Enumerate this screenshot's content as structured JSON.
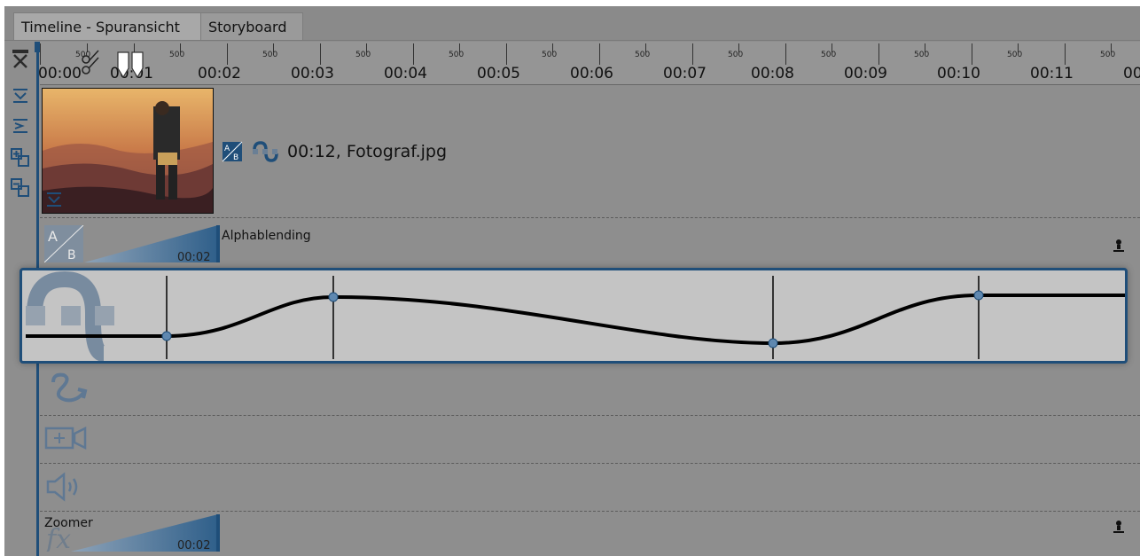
{
  "tabs": [
    {
      "label": "Timeline - Spuransicht",
      "active": true
    },
    {
      "label": "Storyboard",
      "active": false
    }
  ],
  "ruler": {
    "first_label": "00:00",
    "second_label": "00:01",
    "labels": [
      "00:02",
      "00:03",
      "00:04",
      "00:05",
      "00:06",
      "00:07",
      "00:08",
      "00:09",
      "00:10",
      "00:11",
      "00"
    ],
    "sub_labels": [
      "500",
      "500",
      "500",
      "500",
      "500",
      "500",
      "500",
      "500",
      "500",
      "500",
      "500",
      "500"
    ],
    "half_label": "500"
  },
  "clip": {
    "info": "00:12, Fotograf.jpg"
  },
  "effects": {
    "alphablending": {
      "label": "Alphablending",
      "time": "00:02"
    },
    "zoomer": {
      "label": "Zoomer",
      "time": "00:02"
    }
  },
  "colors": {
    "accent": "#1f4e79",
    "background": "#8e8e8e",
    "panel": "#c4c4c4"
  },
  "icons": {
    "left_toolbar": [
      "fit-width-icon",
      "collapse-tracks-icon",
      "expand-tracks-icon",
      "add-track-icon",
      "remove-track-icon",
      "collapse-clip-icon"
    ],
    "track_rows": [
      "wave-curve-icon",
      "camera-pan-icon",
      "volume-icon",
      "fx-icon"
    ]
  }
}
